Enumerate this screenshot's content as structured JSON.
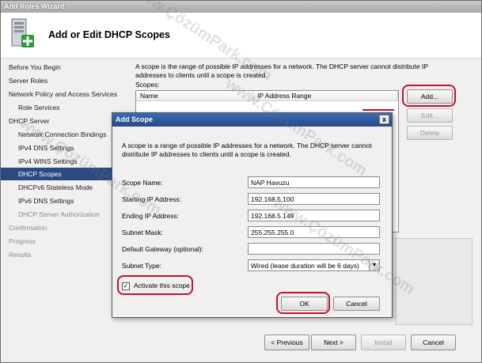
{
  "window": {
    "title": "Add Roles Wizard",
    "header_title": "Add or Edit DHCP Scopes"
  },
  "sidebar": {
    "items": [
      {
        "label": "Before You Begin",
        "level": 0,
        "state": "normal"
      },
      {
        "label": "Server Roles",
        "level": 0,
        "state": "normal"
      },
      {
        "label": "Network Policy and Access Services",
        "level": 0,
        "state": "normal"
      },
      {
        "label": "Role Services",
        "level": 1,
        "state": "normal"
      },
      {
        "label": "DHCP Server",
        "level": 0,
        "state": "normal"
      },
      {
        "label": "Network Connection Bindings",
        "level": 1,
        "state": "normal"
      },
      {
        "label": "IPv4 DNS Settings",
        "level": 1,
        "state": "normal"
      },
      {
        "label": "IPv4 WINS Settings",
        "level": 1,
        "state": "normal"
      },
      {
        "label": "DHCP Scopes",
        "level": 1,
        "state": "selected"
      },
      {
        "label": "DHCPv6 Stateless Mode",
        "level": 1,
        "state": "normal"
      },
      {
        "label": "IPv6 DNS Settings",
        "level": 1,
        "state": "normal"
      },
      {
        "label": "DHCP Server Authorization",
        "level": 1,
        "state": "disabled"
      },
      {
        "label": "Confirmation",
        "level": 0,
        "state": "disabled"
      },
      {
        "label": "Progress",
        "level": 0,
        "state": "disabled"
      },
      {
        "label": "Results",
        "level": 0,
        "state": "disabled"
      }
    ]
  },
  "main": {
    "intro": "A scope is the range of possible IP addresses for a network. The DHCP server cannot distribute IP addresses to clients until a scope is created.",
    "scopes_label": "Scopes:",
    "columns": [
      "Name",
      "IP Address Range"
    ],
    "buttons": {
      "add": "Add...",
      "edit": "Edit...",
      "delete": "Delete"
    }
  },
  "footer": {
    "previous": "< Previous",
    "next": "Next >",
    "install": "Install",
    "cancel": "Cancel"
  },
  "dialog": {
    "title": "Add Scope",
    "close": "x",
    "description": "A scope is a range of possible IP addresses for a network. The DHCP server cannot distribute IP addresses to clients until a scope is created.",
    "fields": {
      "scope_name": {
        "label": "Scope Name:",
        "value": "NAP Havuzu"
      },
      "starting_ip": {
        "label": "Starting IP Address:",
        "value": "192.168.5.100"
      },
      "ending_ip": {
        "label": "Ending IP Address:",
        "value": "192.168.5.149"
      },
      "subnet_mask": {
        "label": "Subnet Mask:",
        "value": "255.255.255.0"
      },
      "default_gateway": {
        "label": "Default Gateway (optional):",
        "value": ""
      },
      "subnet_type": {
        "label": "Subnet Type:",
        "value": "Wired (lease duration will be 6 days)"
      }
    },
    "activate": {
      "label": "Activate this scope",
      "checked": true,
      "mark": "✓"
    },
    "ok": "OK",
    "cancel": "Cancel"
  },
  "watermark": "www.ÇözümPark.com",
  "colors": {
    "highlight": "#c8102e",
    "selected_nav": "#2b4b80",
    "dialog_titlebar": "#24498a"
  }
}
